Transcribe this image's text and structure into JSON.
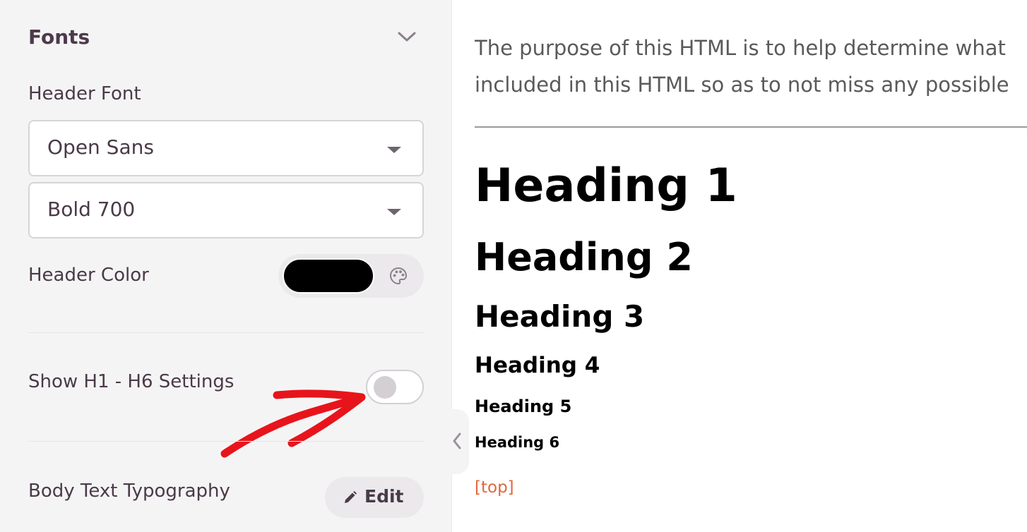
{
  "panel": {
    "section_title": "Fonts",
    "header_font": {
      "label": "Header Font",
      "family": "Open Sans",
      "weight": "Bold 700"
    },
    "header_color": {
      "label": "Header Color",
      "value": "#000000"
    },
    "h1_h6_toggle": {
      "label": "Show H1 - H6 Settings",
      "enabled": false
    },
    "body_typography": {
      "label": "Body Text Typography",
      "edit_label": "Edit"
    },
    "annotation_color": "#e8141b"
  },
  "preview": {
    "intro_lines": [
      "The purpose of this HTML is to help determine what",
      "included in this HTML so as to not miss any possible"
    ],
    "headings": [
      "Heading 1",
      "Heading 2",
      "Heading 3",
      "Heading 4",
      "Heading 5",
      "Heading 6"
    ],
    "top_link": "[top]",
    "link_color": "#e0673b"
  }
}
